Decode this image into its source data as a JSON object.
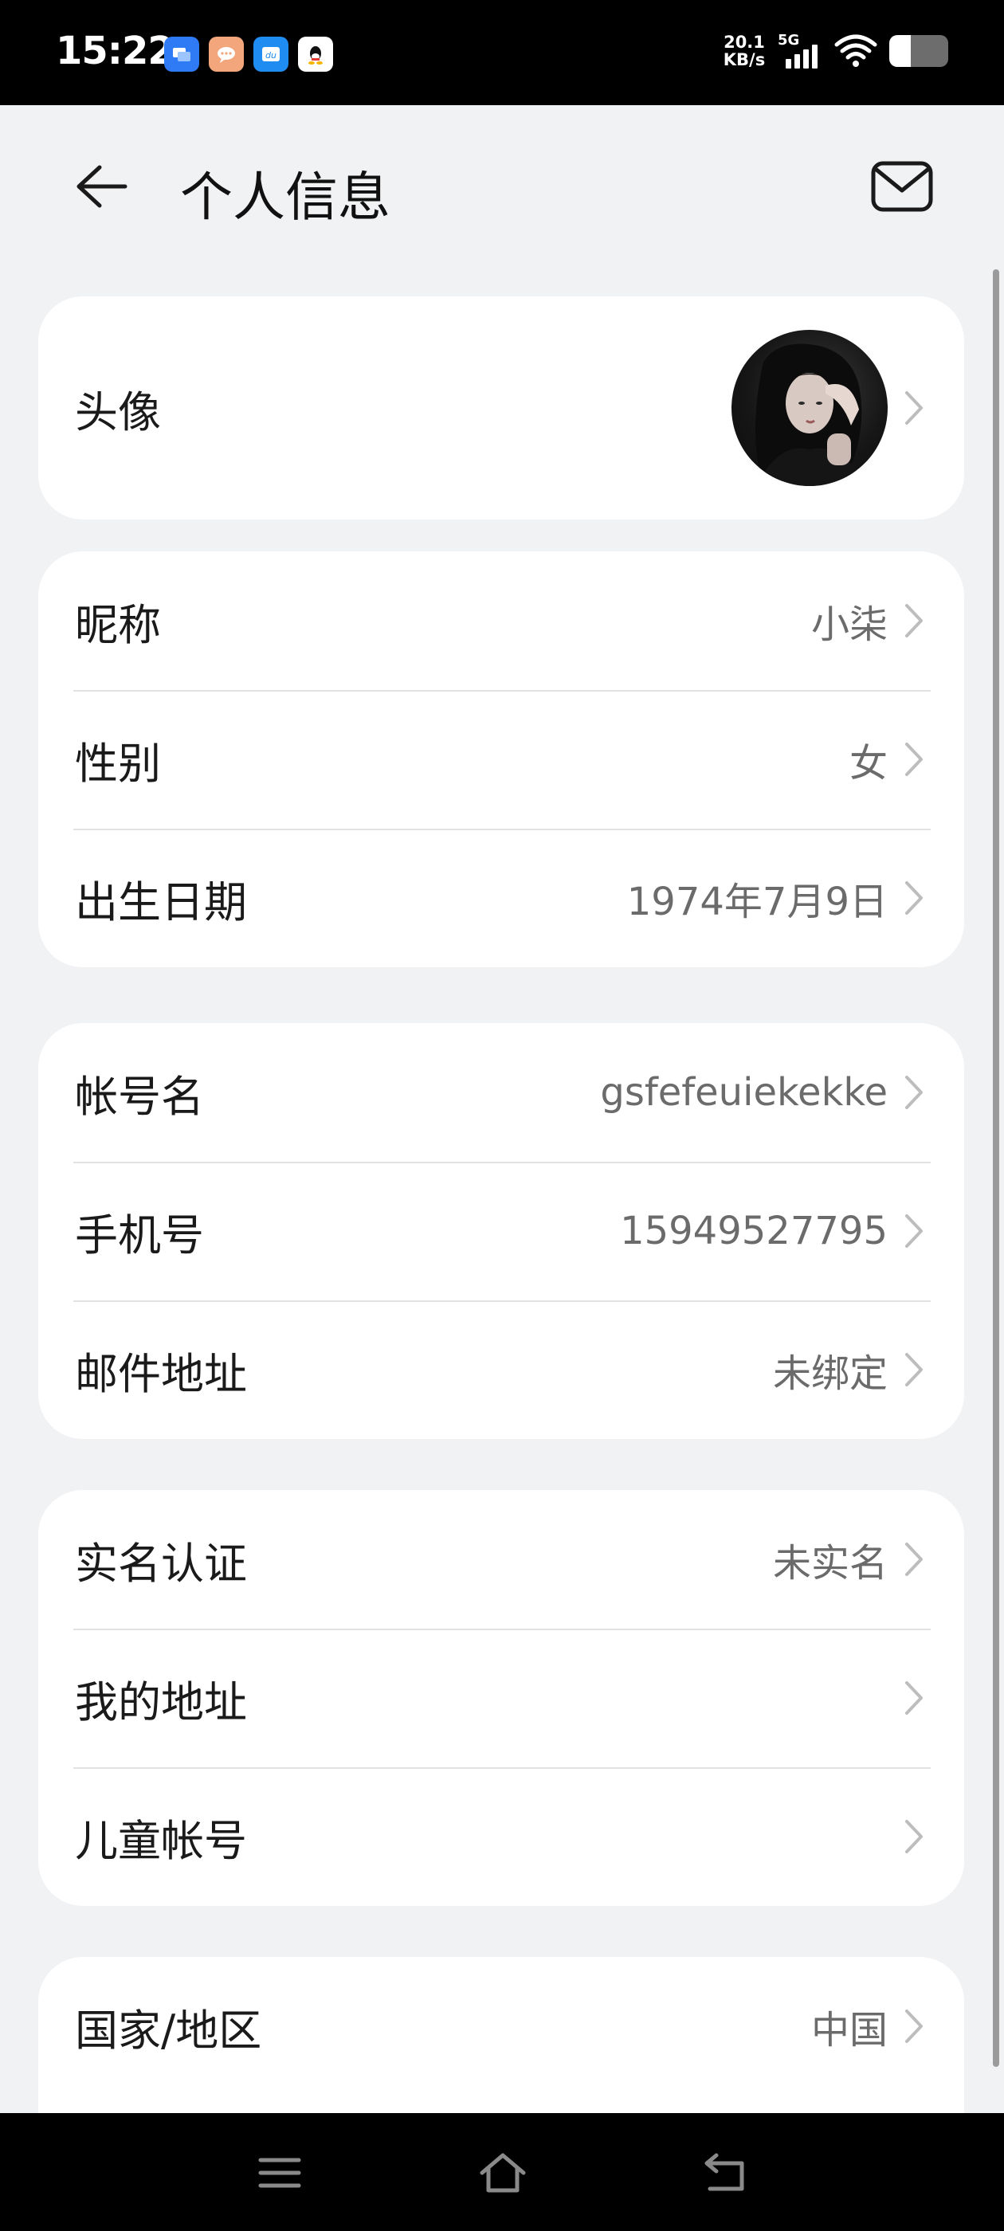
{
  "status_bar": {
    "time": "15:22",
    "net_speed_value": "20.1",
    "net_speed_unit": "KB/s",
    "network_type": "5G",
    "battery_level": 0.36,
    "notification_icons": [
      "message-icon",
      "chat-icon",
      "du-app-icon",
      "qq-icon"
    ]
  },
  "header": {
    "title": "个人信息",
    "back_icon": "arrow-left-icon",
    "mail_icon": "mail-icon"
  },
  "profile": {
    "avatar_label": "头像"
  },
  "basic_info": [
    {
      "label": "昵称",
      "value": "小柒"
    },
    {
      "label": "性别",
      "value": "女"
    },
    {
      "label": "出生日期",
      "value": "1974年7月9日"
    }
  ],
  "account_info": [
    {
      "label": "帐号名",
      "value": "gsfefeuiekekke"
    },
    {
      "label": "手机号",
      "value": "15949527795"
    },
    {
      "label": "邮件地址",
      "value": "未绑定"
    }
  ],
  "other_info": [
    {
      "label": "实名认证",
      "value": "未实名"
    },
    {
      "label": "我的地址",
      "value": ""
    },
    {
      "label": "儿童帐号",
      "value": ""
    }
  ],
  "region_info": [
    {
      "label": "国家/地区",
      "value": "中国"
    }
  ],
  "nav_bar": {
    "buttons": [
      "menu-icon",
      "home-icon",
      "back-nav-icon"
    ]
  },
  "colors": {
    "background": "#f1f2f4",
    "card": "#ffffff",
    "primary_text": "#1a1a1a",
    "secondary_text": "#6b6b6b",
    "chevron": "#bdbdbd"
  }
}
